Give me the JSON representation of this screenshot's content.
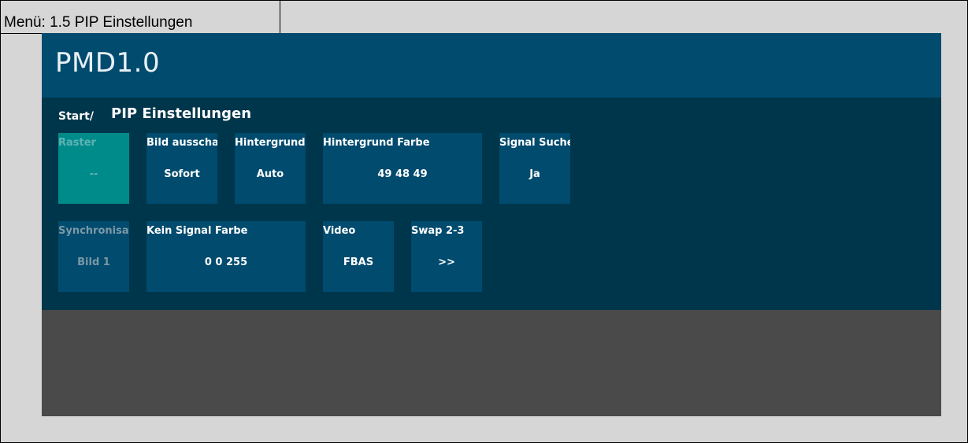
{
  "menu_caption": "Menü: 1.5 PIP Einstellungen",
  "app_title": "PMD1.0",
  "breadcrumb": {
    "root": "Start/",
    "current": "PIP Einstellungen"
  },
  "tiles": [
    {
      "label": "Raster",
      "value": "--"
    },
    {
      "label": "Bild ausschalten",
      "value": "Sofort"
    },
    {
      "label": "Hintergrund",
      "value": "Auto"
    },
    {
      "label": "Hintergrund Farbe",
      "value": "49 48 49"
    },
    {
      "label": "Signal Suche",
      "value": "Ja"
    },
    {
      "label": "Synchronisation",
      "value": "Bild 1"
    },
    {
      "label": "Kein Signal Farbe",
      "value": "0 0 255"
    },
    {
      "label": "Video",
      "value": "FBAS"
    },
    {
      "label": "Swap 2-3",
      "value": ">>"
    }
  ],
  "colors": {
    "header": "#004b6e",
    "panel": "#00364b",
    "tile": "#004b6e",
    "tile_selected": "#008b8b",
    "footer": "#4a4a4a"
  }
}
